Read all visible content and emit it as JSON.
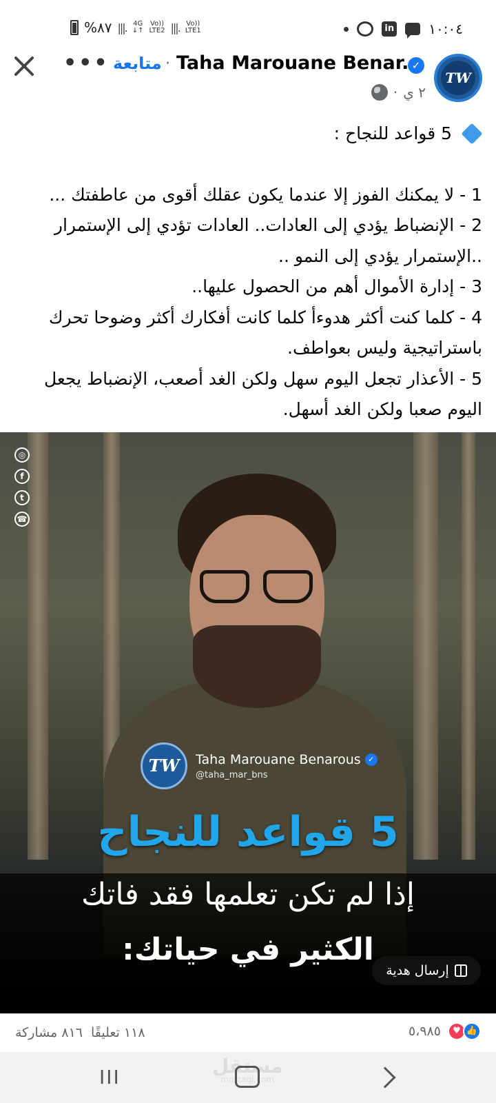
{
  "status_bar": {
    "battery_text": "%٨٧",
    "net_1": "4G",
    "net_2_top": "Vo))",
    "net_2_bottom": "LTE2",
    "net_3_top": "Vo))",
    "net_3_bottom": "LTE1",
    "time": "١٠:٠٤"
  },
  "header": {
    "author_name": "Taha Marouane Benar...",
    "follow_label": "متابعة",
    "separator": "·",
    "post_age": "٢ ي",
    "meta_separator": "·",
    "avatar_initials": "TW",
    "more_label": "•••"
  },
  "post": {
    "title": "5 قواعد للنجاح :",
    "rules": [
      "1 - لا يمكنك الفوز إلا عندما يكون عقلك أقوى من عاطفتك ...",
      "2 - الإنضباط يؤدي إلى العادات.. العادات تؤدي إلى الإستمرار ..الإستمرار يؤدي إلى النمو ..",
      "3 - إدارة الأموال أهم من الحصول عليها..",
      "4 - كلما كنت أكثر هدوءأ كلما كانت أفكارك أكثر وضوحا تحرك باستراتيجية وليس بعواطف.",
      "5 - الأعذار تجعل اليوم سهل ولكن الغد أصعب، الإنضباط يجعل اليوم صعبا ولكن الغد أسهل."
    ]
  },
  "image": {
    "brand_logo": "TW",
    "brand_name": "Taha Marouane Benarous",
    "brand_handle": "@taha_mar_bns",
    "headline": "5 قواعد للنجاح",
    "subline_1": "إذا لم تكن تعلمها فقد فاتك",
    "subline_2": "الكثير في حياتك:",
    "gift_label": "إرسال هدية",
    "social_icons": [
      "instagram-icon",
      "facebook-icon",
      "twitter-icon",
      "whatsapp-icon"
    ]
  },
  "stats": {
    "reactions_count": "٥،٩٨٥",
    "comments": "١١٨ تعليقًا",
    "shares": "٨١٦ مشاركة"
  },
  "nav": {
    "recent_label": "III",
    "watermark": "مستقل",
    "watermark_sub": "mostaql.com"
  },
  "colors": {
    "brand_blue": "#1877f2",
    "headline_blue": "#22a6ea",
    "love_red": "#f33e58",
    "muted_text": "#65676b"
  }
}
